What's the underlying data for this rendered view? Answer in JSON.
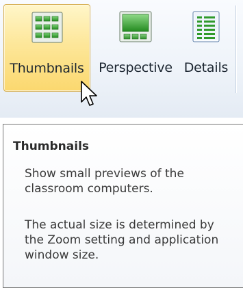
{
  "ribbon": {
    "buttons": [
      {
        "label": "Thumbnails",
        "icon": "thumbnails-grid-icon",
        "state": "hover"
      },
      {
        "label": "Perspective",
        "icon": "perspective-view-icon",
        "state": "normal"
      },
      {
        "label": "Details",
        "icon": "details-list-icon",
        "state": "normal"
      }
    ]
  },
  "tooltip": {
    "title": "Thumbnails",
    "paragraph1": "Show small previews of the classroom computers.",
    "paragraph2": "The actual size is determined by the Zoom setting and application window size."
  },
  "colors": {
    "hover_top": "#fff6c9",
    "hover_bottom": "#fbd86f",
    "hover_border": "#d5ad4f",
    "icon_green": "#3ea83a"
  }
}
